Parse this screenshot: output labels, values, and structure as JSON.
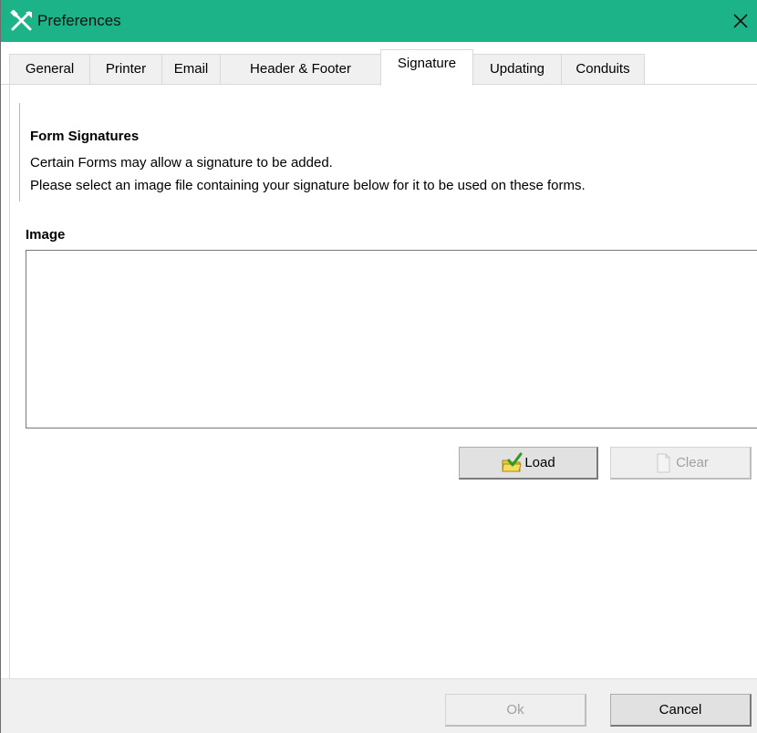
{
  "window": {
    "title": "Preferences"
  },
  "tabs": [
    {
      "label": "General"
    },
    {
      "label": "Printer"
    },
    {
      "label": "Email"
    },
    {
      "label": "Header & Footer"
    },
    {
      "label": "Signature",
      "active": true
    },
    {
      "label": "Updating"
    },
    {
      "label": "Conduits"
    }
  ],
  "signature": {
    "heading": "Form Signatures",
    "line1": "Certain Forms may allow a signature to be added.",
    "line2": "Please select an image file containing your signature below for it to be used on these forms.",
    "image_label": "Image",
    "load_label": "Load",
    "clear_label": "Clear"
  },
  "footer": {
    "ok_label": "Ok",
    "cancel_label": "Cancel"
  },
  "icons": {
    "app": "tools-icon",
    "close": "close-icon",
    "load": "folder-check-icon",
    "clear": "blank-document-icon"
  },
  "colors": {
    "titlebar": "#1db389"
  }
}
